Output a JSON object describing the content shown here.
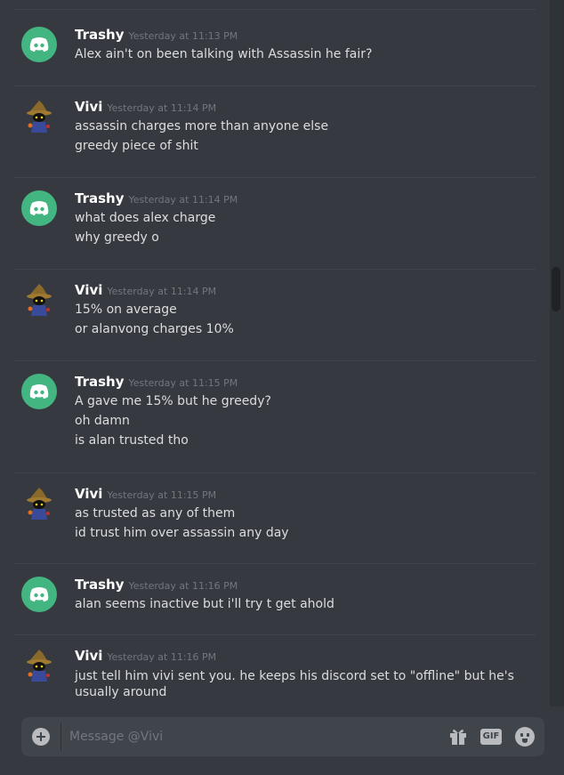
{
  "icons": {
    "discord_avatar": "discord-logo-icon",
    "vivi_avatar": "black-mage-icon",
    "attach": "plus-circle-icon",
    "gift": "gift-icon",
    "gif": "gif-icon",
    "emoji": "emoji-icon"
  },
  "colors": {
    "background": "#36393f",
    "discord_green": "#43b581",
    "composer": "#40444b",
    "timestamp": "#72767d"
  },
  "messages": [
    {
      "author": "Trashy",
      "time": "Yesterday at 11:13 PM",
      "lines": [
        "Alex ain't on been talking with Assassin he fair?"
      ]
    },
    {
      "author": "Vivi",
      "time": "Yesterday at 11:14 PM",
      "lines": [
        "assassin charges more than anyone else",
        "greedy piece of shit"
      ]
    },
    {
      "author": "Trashy",
      "time": "Yesterday at 11:14 PM",
      "lines": [
        "what does alex charge",
        "why greedy o"
      ]
    },
    {
      "author": "Vivi",
      "time": "Yesterday at 11:14 PM",
      "lines": [
        "15% on average",
        "or alanvong charges 10%"
      ]
    },
    {
      "author": "Trashy",
      "time": "Yesterday at 11:15 PM",
      "lines": [
        "A gave me 15% but he greedy?",
        "oh damn",
        "is alan trusted tho"
      ]
    },
    {
      "author": "Vivi",
      "time": "Yesterday at 11:15 PM",
      "lines": [
        "as trusted as any of them",
        "id trust him over assassin any day"
      ]
    },
    {
      "author": "Trashy",
      "time": "Yesterday at 11:16 PM",
      "lines": [
        "alan seems inactive but i'll try t get ahold"
      ]
    },
    {
      "author": "Vivi",
      "time": "Yesterday at 11:16 PM",
      "lines": [
        "just tell him vivi sent you. he keeps his discord set to \"offline\" but he's usually around"
      ]
    }
  ],
  "composer": {
    "placeholder": "Message @Vivi",
    "gif_label": "GIF"
  }
}
